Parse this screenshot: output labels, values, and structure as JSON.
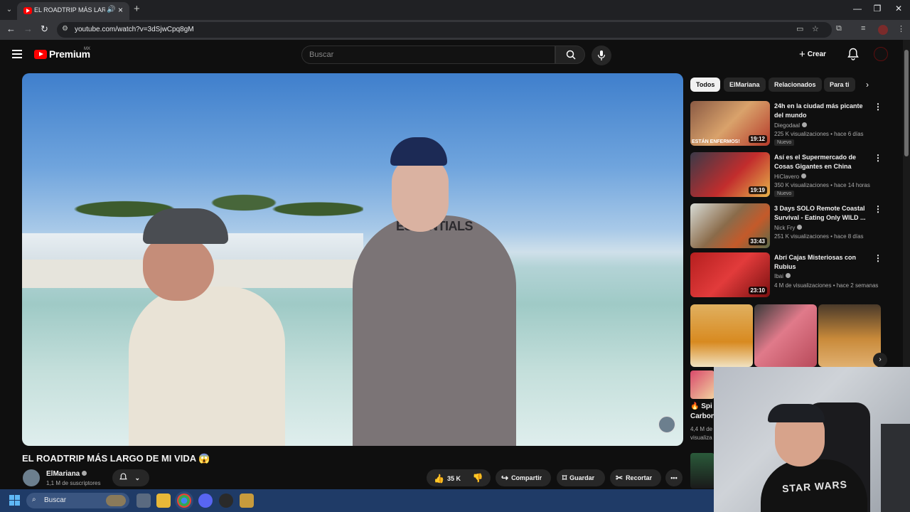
{
  "browser": {
    "tab_title": "EL ROADTRIP MÁS LARGO DE MI VIDA",
    "url": "youtube.com/watch?v=3dSjwCpq8gM"
  },
  "header": {
    "brand": "Premium",
    "country": "MX",
    "search_placeholder": "Buscar",
    "create_label": "Crear"
  },
  "player": {
    "hoodie_text": "ESSENTIALS"
  },
  "video": {
    "title": "EL ROADTRIP MÁS LARGO DE MI VIDA 😱",
    "channel": "ElMariana",
    "subscribers": "1,1 M de suscriptores",
    "likes": "35 K",
    "share": "Compartir",
    "save": "Guardar",
    "clip": "Recortar"
  },
  "chips": [
    "Todos",
    "ElMariana",
    "Relacionados",
    "Para ti"
  ],
  "recommendations": [
    {
      "title": "24h en la ciudad más picante del mundo",
      "channel": "Diegodaal",
      "meta": "225 K visualizaciones • hace 6 días",
      "badge": "Nuevo",
      "duration": "19:12",
      "thumb_text": "ESTÁN ENFERMOS!"
    },
    {
      "title": "Así es el Supermercado de Cosas Gigantes en China",
      "channel": "HiClavero",
      "meta": "350 K visualizaciones • hace 14 horas",
      "badge": "Nuevo",
      "duration": "19:19"
    },
    {
      "title": "3 Days SOLO Remote Coastal Survival - Eating Only WILD ...",
      "channel": "Nick Fry",
      "meta": "251 K visualizaciones • hace 8 días",
      "duration": "33:43"
    },
    {
      "title": "Abrí Cajas Misteriosas con Rubius",
      "channel": "Ibai",
      "meta": "4 M de visualizaciones • hace 2 semanas",
      "duration": "23:10"
    }
  ],
  "partial_rec": {
    "title_line1": "🔥 Spi",
    "title_line2": "Carbon",
    "meta_line1": "4,4 M de",
    "meta_line2": "visualiza"
  },
  "webcam": {
    "shirt_text": "STAR WARS"
  },
  "taskbar": {
    "search_label": "Buscar"
  }
}
